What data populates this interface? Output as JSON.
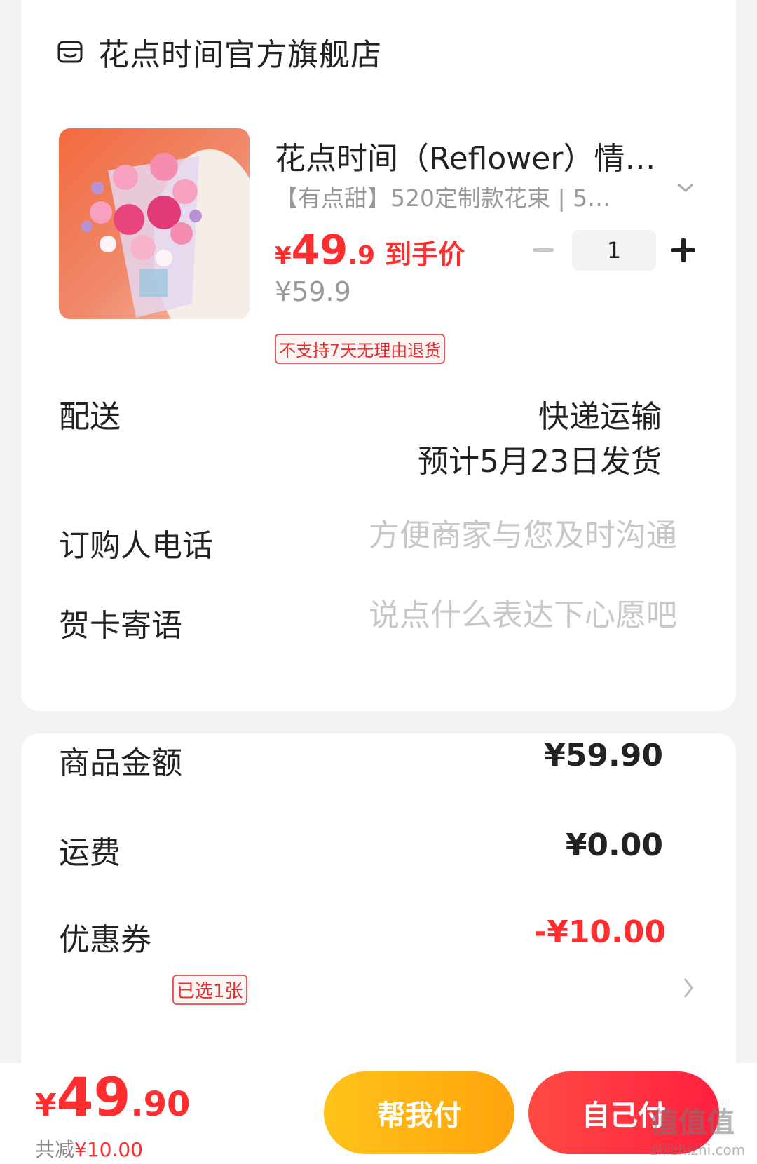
{
  "shop": {
    "icon": "store-icon",
    "name": "花点时间官方旗舰店"
  },
  "product": {
    "image": "flower-bouquet-image",
    "title": "花点时间（Reflower）情…",
    "sku": "【有点甜】520定制款花束 | 5…",
    "price_currency": "¥",
    "price_int": "49",
    "price_dec": ".9",
    "price_tag": "到手价",
    "original_price": "¥59.9",
    "quantity": "1",
    "return_policy": "不支持7天无理由退货"
  },
  "delivery": {
    "label": "配送",
    "method": "快递运输",
    "estimate": "预计5月23日发货"
  },
  "phone": {
    "label": "订购人电话",
    "placeholder": "方便商家与您及时沟通"
  },
  "card_message": {
    "label": "贺卡寄语",
    "placeholder": "说点什么表达下心愿吧"
  },
  "summary": {
    "goods_label": "商品金额",
    "goods_amount": "¥59.90",
    "shipping_label": "运费",
    "shipping_amount": "¥0.00",
    "coupon_label": "优惠券",
    "coupon_badge": "已选1张",
    "coupon_amount": "-¥10.00"
  },
  "footer": {
    "total_currency": "¥",
    "total_int": "49",
    "total_dec": ".90",
    "discount_prefix": "共减",
    "discount_amount": "¥10.00",
    "help_pay_label": "帮我付",
    "self_pay_label": "自己付",
    "watermark": "值值值",
    "watermark_sub": "zhizhizhi.com"
  },
  "colors": {
    "accent_red": "#ff2d2d",
    "help_pay_yellow": "#ffb414",
    "self_pay_red": "#ff2f40"
  }
}
